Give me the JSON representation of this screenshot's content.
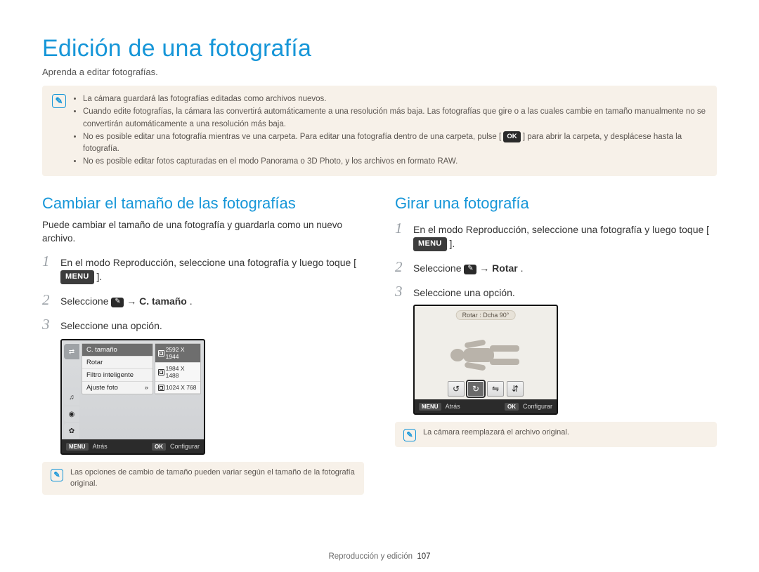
{
  "title": "Edición de una fotografía",
  "subtitle": "Aprenda a editar fotografías.",
  "main_notes": [
    "La cámara guardará las fotografías editadas como archivos nuevos.",
    "Cuando edite fotografías, la cámara las convertirá automáticamente a una resolución más baja. Las fotografías que gire o a las cuales cambie en tamaño manualmente no se convertirán automáticamente a una resolución más baja.",
    "No es posible editar una fotografía mientras ve una carpeta. Para editar una fotografía dentro de una carpeta, pulse [",
    "] para abrir la carpeta, y desplácese hasta la fotografía.",
    "No es posible editar fotos capturadas en el modo Panorama o 3D Photo, y los archivos en formato RAW."
  ],
  "ok_label": "OK",
  "left": {
    "heading": "Cambiar el tamaño de las fotografías",
    "intro": "Puede cambiar el tamaño de una fotografía y guardarla como un nuevo archivo.",
    "steps": {
      "s1a": "En el modo Reproducción, seleccione una fotografía y luego toque [",
      "menu_label": "MENU",
      "s1b": "].",
      "s2a": "Seleccione ",
      "s2b": " → ",
      "s2c": "C. tamaño",
      "s2d": ".",
      "s3": "Seleccione una opción."
    },
    "shot": {
      "menu_items": [
        "C. tamaño",
        "Rotar",
        "Filtro inteligente",
        "Ajuste foto"
      ],
      "options": [
        "2592 X 1944",
        "1984 X 1488",
        "1024 X 768"
      ],
      "footer_back_label": "MENU",
      "footer_back": "Atrás",
      "footer_ok_label": "OK",
      "footer_ok": "Configurar"
    },
    "note": "Las opciones de cambio de tamaño pueden variar según el tamaño de la fotografía original."
  },
  "right": {
    "heading": "Girar una fotografía",
    "steps": {
      "s1a": "En el modo Reproducción, seleccione una fotografía y luego toque [",
      "menu_label": "MENU",
      "s1b": "].",
      "s2a": "Seleccione ",
      "s2b": " → ",
      "s2c": "Rotar",
      "s2d": ".",
      "s3": "Seleccione una opción."
    },
    "shot": {
      "tag": "Rotar : Dcha 90°",
      "footer_back_label": "MENU",
      "footer_back": "Atrás",
      "footer_ok_label": "OK",
      "footer_ok": "Configurar"
    },
    "note": "La cámara reemplazará el archivo original."
  },
  "footer_section": "Reproducción y edición",
  "footer_page": "107"
}
